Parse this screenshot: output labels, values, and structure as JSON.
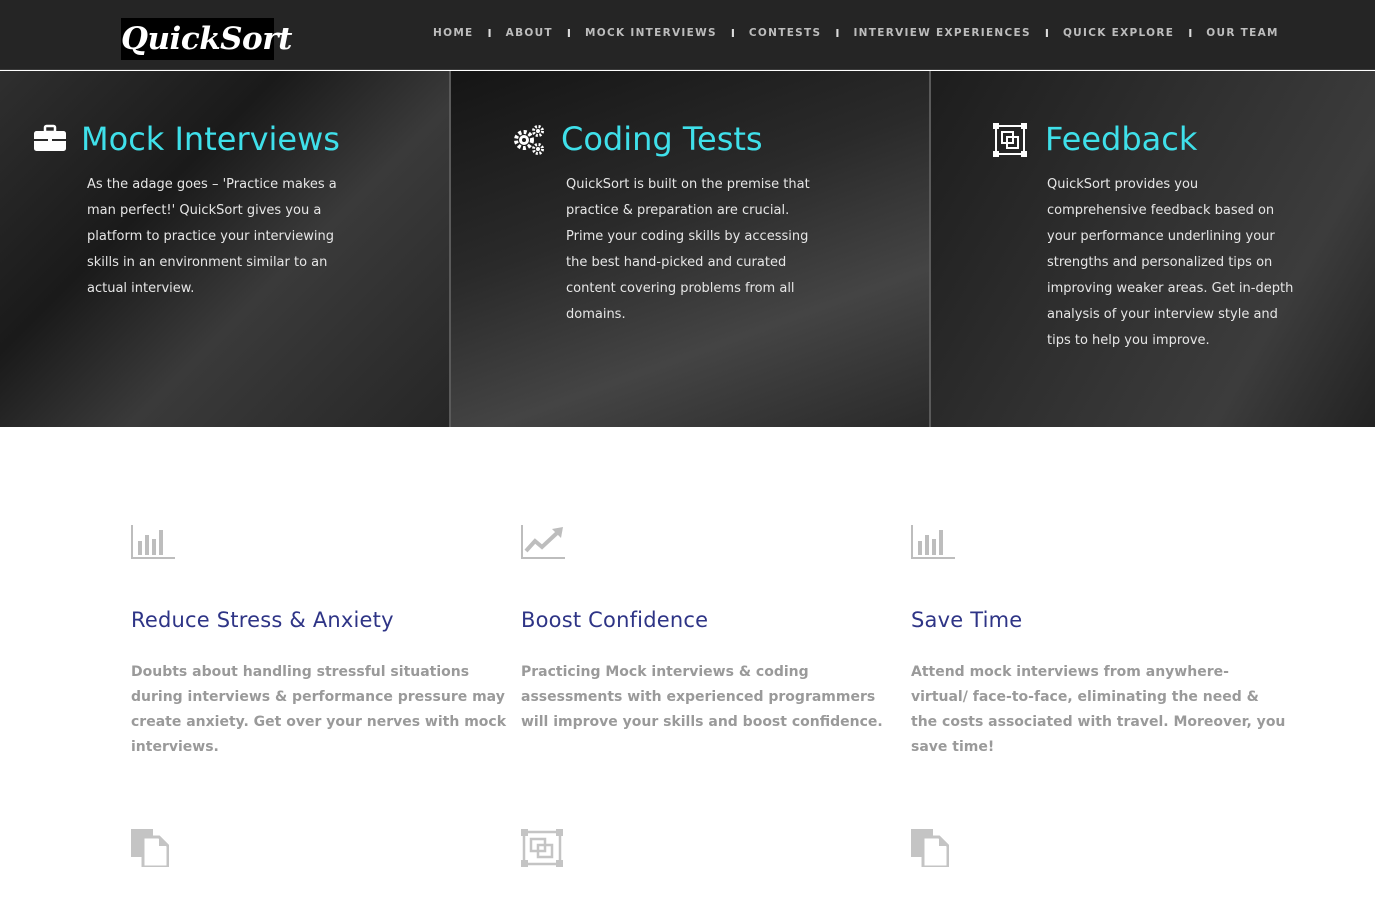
{
  "brand": {
    "logo_text": "QuickSort"
  },
  "nav": {
    "items": [
      {
        "label": "HOME"
      },
      {
        "label": "ABOUT"
      },
      {
        "label": "MOCK INTERVIEWS"
      },
      {
        "label": "CONTESTS"
      },
      {
        "label": "INTERVIEW EXPERIENCES"
      },
      {
        "label": "QUICK EXPLORE"
      },
      {
        "label": "OUR TEAM"
      }
    ],
    "separator": "I"
  },
  "hero": {
    "accent_color": "#3fe0ea",
    "cards": [
      {
        "icon": "briefcase-icon",
        "title": "Mock Interviews",
        "text": "As the adage goes – 'Practice makes a\nman perfect!' QuickSort gives you a\nplatform to practice your interviewing\nskills in an environment similar to an\nactual interview."
      },
      {
        "icon": "gears-icon",
        "title": "Coding Tests",
        "text": "QuickSort is built on the premise that\npractice & preparation are crucial.\nPrime your coding skills by accessing\nthe best hand-picked and curated\ncontent covering problems from all\ndomains."
      },
      {
        "icon": "frame-icon",
        "title": "Feedback",
        "text": "QuickSort provides you\ncomprehensive feedback based on\nyour performance underlining your\nstrengths and personalized tips on\nimproving weaker areas. Get in-depth\nanalysis of your interview style and\ntips to help you improve."
      }
    ]
  },
  "features": {
    "title_color": "#2e3486",
    "items": [
      {
        "icon": "bar-chart-icon",
        "title": "Reduce Stress & Anxiety",
        "text": "Doubts about handling stressful situations\nduring interviews & performance pressure may\ncreate anxiety. Get over your nerves with mock\ninterviews."
      },
      {
        "icon": "line-chart-icon",
        "title": "Boost Confidence",
        "text": "Practicing Mock interviews & coding\nassessments with experienced programmers\nwill improve your skills and boost confidence."
      },
      {
        "icon": "bar-chart-icon",
        "title": "Save Time",
        "text": "Attend mock interviews from anywhere-\nvirtual/ face-to-face, eliminating the need &\nthe costs associated with travel. Moreover, you\nsave time!"
      }
    ],
    "second_row_icons": [
      "documents-icon",
      "frame-icon",
      "documents-icon"
    ]
  }
}
